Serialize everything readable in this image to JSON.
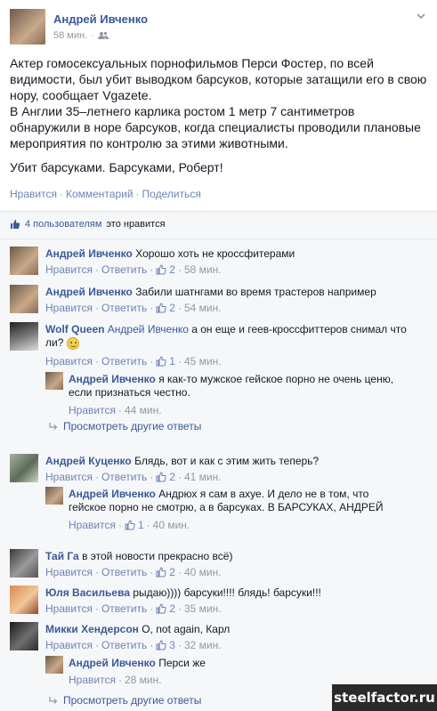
{
  "post": {
    "author": "Андрей Ивченко",
    "time": "58 мин.",
    "privacy_icon": "friends-icon",
    "body_p1": "Актер гомосексуальных порнофильмов Перси Фостер, по всей видимости, был убит выводком барсуков, которые затащили его в свою нору, сообщает Vgazete.",
    "body_p2": "В Англии 35–летнего карлика ростом 1 метр 7 сантиметров обнаружили в норе барсуков, когда специалисты проводили плановые мероприятия по контролю за этими животными.",
    "body_p3": "Убит барсуками. Барсуками, Роберт!",
    "action_like": "Нравится",
    "action_comment": "Комментарий",
    "action_share": "Поделиться",
    "separator": "·"
  },
  "likes": {
    "count_text": "4 пользователям",
    "suffix": "это нравится"
  },
  "common": {
    "like": "Нравится",
    "reply": "Ответить",
    "dot": "·",
    "more_replies": "Просмотреть другие ответы"
  },
  "comments": [
    {
      "author": "Андрей Ивченко",
      "text": "Хорошо хоть не кроссфитерами",
      "likes": "2",
      "time": "58 мин."
    },
    {
      "author": "Андрей Ивченко",
      "text": "Забили шатнгами во время трастеров например",
      "likes": "2",
      "time": "54 мин."
    },
    {
      "author": "Wolf Queen",
      "mention": "Андрей Ивченко",
      "text_line1": "а он еще и геев-кроссфиттеров снимал что",
      "text_line2": "ли?",
      "likes": "1",
      "time": "45 мин.",
      "reply": {
        "author": "Андрей Ивченко",
        "text_line1": "я как-то мужское гейское порно не очень ценю,",
        "text_line2": "если признаться честно.",
        "time": "44 мин."
      }
    },
    {
      "author": "Андрей Куценко",
      "text": "Блядь, вот и как с этим жить теперь?",
      "likes": "2",
      "time": "41 мин.",
      "reply": {
        "author": "Андрей Ивченко",
        "text_line1": "Андрюх я сам в ахуе. И дело не в том, что",
        "text_line2": "гейское порно не смотрю, а в барсуках. В БАРСУКАХ, АНДРЕЙ",
        "likes": "1",
        "time": "40 мин."
      }
    },
    {
      "author": "Тай Га",
      "text": "в этой новости прекрасно всё)",
      "likes": "2",
      "time": "40 мин."
    },
    {
      "author": "Юля Васильева",
      "text": "рыдаю)))) барсуки!!!! блядь! барсуки!!!",
      "likes": "2",
      "time": "35 мин."
    },
    {
      "author": "Микки Хендерсон",
      "text": "O, not again, Карл",
      "likes": "3",
      "time": "32 мин.",
      "reply": {
        "author": "Андрей Ивченко",
        "text": "Перси же",
        "time": "28 мин."
      }
    }
  ],
  "watermark": "steelfactor.ru",
  "colors": {
    "link": "#3b5998",
    "muted": "#9197a3",
    "action": "#6d84b4",
    "bg_feedback": "#f6f7f9"
  }
}
